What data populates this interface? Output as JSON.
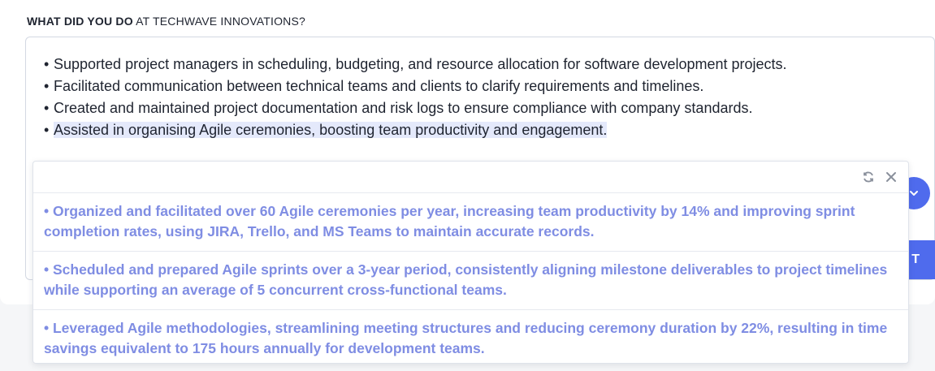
{
  "question": {
    "bold": "WHAT DID YOU DO",
    "rest": " AT TECHWAVE INNOVATIONS?"
  },
  "editor": {
    "bullet_char": "•",
    "bullets": [
      "Supported project managers in scheduling, budgeting, and resource allocation for software development projects.",
      "Facilitated communication between technical teams and clients to clarify requirements and timelines.",
      "Created and maintained project documentation and risk logs to ensure compliance with company standards.",
      "Assisted in organising Agile ceremonies, boosting team productivity and engagement."
    ]
  },
  "buttons": {
    "right_partial_label": "T"
  },
  "popup": {
    "tools": [
      "refresh-icon",
      "close-icon"
    ],
    "suggestions": [
      "• Organized and facilitated over 60 Agile ceremonies per year, increasing team productivity by 14% and improving sprint completion rates, using JIRA, Trello, and MS Teams to maintain accurate records.",
      "• Scheduled and prepared Agile sprints over a 3-year period, consistently aligning milestone deliverables to project timelines while supporting an average of 5 concurrent cross-functional teams.",
      "• Leveraged Agile methodologies, streamlining meeting structures and reducing ceremony duration by 22%, resulting in time savings equivalent to 175 hours annually for development teams."
    ]
  },
  "colors": {
    "accent": "#4f6bed",
    "suggestion_text": "#7f8de3",
    "highlight": "#e4e9fb"
  }
}
